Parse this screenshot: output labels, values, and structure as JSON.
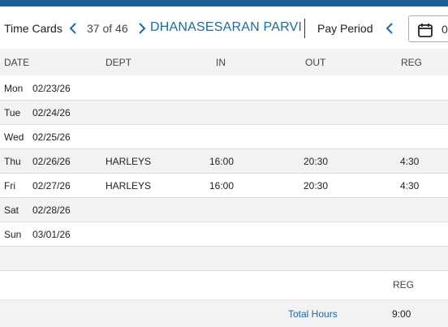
{
  "header": {
    "title": "Time Cards",
    "counter": "37 of 46",
    "employee_name": "DHANASESARAN PARVI",
    "pay_period_label": "Pay Period",
    "date_value": "0",
    "icons": {
      "prev": "chevron-left-icon",
      "next": "chevron-right-icon",
      "calendar": "calendar-icon"
    }
  },
  "table": {
    "columns": [
      "DATE",
      "DEPT",
      "IN",
      "OUT",
      "REG"
    ],
    "rows": [
      {
        "dow": "Mon",
        "date": "02/23/26",
        "dept": "",
        "in": "",
        "out": "",
        "reg": ""
      },
      {
        "dow": "Tue",
        "date": "02/24/26",
        "dept": "",
        "in": "",
        "out": "",
        "reg": ""
      },
      {
        "dow": "Wed",
        "date": "02/25/26",
        "dept": "",
        "in": "",
        "out": "",
        "reg": ""
      },
      {
        "dow": "Thu",
        "date": "02/26/26",
        "dept": "HARLEYS",
        "in": "16:00",
        "out": "20:30",
        "reg": "4:30"
      },
      {
        "dow": "Fri",
        "date": "02/27/26",
        "dept": "HARLEYS",
        "in": "16:00",
        "out": "20:30",
        "reg": "4:30"
      },
      {
        "dow": "Sat",
        "date": "02/28/26",
        "dept": "",
        "in": "",
        "out": "",
        "reg": ""
      },
      {
        "dow": "Sun",
        "date": "03/01/26",
        "dept": "",
        "in": "",
        "out": "",
        "reg": ""
      }
    ]
  },
  "summary": {
    "reg_header": "REG",
    "total_label": "Total Hours",
    "total_value": "9:00"
  },
  "colors": {
    "accent": "#1b6aa5",
    "topbar": "#1b5f96",
    "row_alt": "#f2f2f2"
  }
}
